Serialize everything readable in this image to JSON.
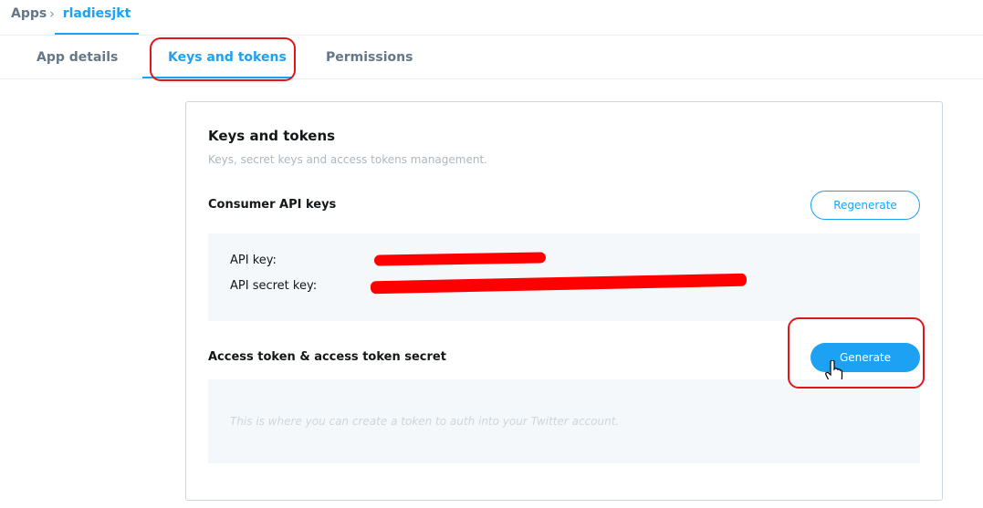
{
  "breadcrumb": {
    "root": "Apps",
    "separator": ">",
    "app_name": "rladiesjkt"
  },
  "tabs": [
    {
      "label": "App details",
      "active": false
    },
    {
      "label": "Keys and tokens",
      "active": true
    },
    {
      "label": "Permissions",
      "active": false
    }
  ],
  "card": {
    "title": "Keys and tokens",
    "subtitle": "Keys, secret keys and access tokens management.",
    "consumer": {
      "title": "Consumer API keys",
      "regenerate_label": "Regenerate",
      "api_key_label": "API key:",
      "api_secret_label": "API secret key:"
    },
    "access": {
      "title": "Access token & access token secret",
      "generate_label": "Generate",
      "placeholder": "This is where you can create a token to auth into your Twitter account."
    }
  },
  "colors": {
    "accent": "#1da1f2",
    "annotation": "#e0161b",
    "redaction": "#ff0000"
  }
}
